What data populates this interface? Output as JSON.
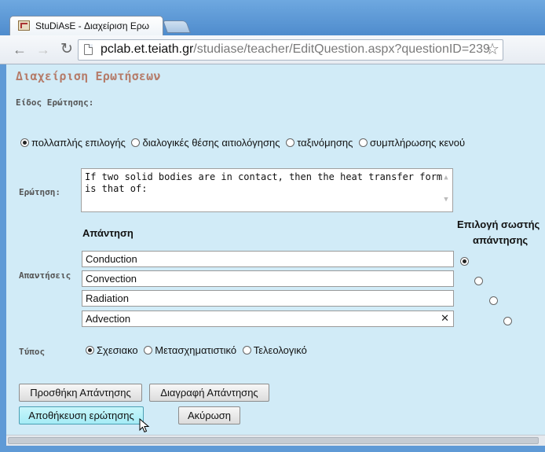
{
  "browser": {
    "tab_title": "StuDiAsE - Διαχείριση Ερω",
    "url_host": "pclab.et.teiath.gr",
    "url_path": "/studiase/teacher/EditQuestion.aspx?questionID=239"
  },
  "page": {
    "title": "Διαχείριση Ερωτήσεων",
    "question_type_label": "Είδος Ερώτησης:",
    "question_types": [
      {
        "label": "πολλαπλής επιλογής",
        "checked": true
      },
      {
        "label": "διαλογικές θέσης αιτιολόγησης",
        "checked": false
      },
      {
        "label": "ταξινόμησης",
        "checked": false
      },
      {
        "label": "συμπλήρωσης κενού",
        "checked": false
      }
    ],
    "question_label": "Ερώτηση:",
    "question_text": "If two solid bodies are in contact, then the heat transfer form is that of:",
    "answers_label": "Απαντήσεις",
    "answer_header": "Απάντηση",
    "correct_header_line1": "Επιλογή σωστής",
    "correct_header_line2": "απάντησης",
    "answers": [
      {
        "value": "Conduction",
        "correct": true
      },
      {
        "value": "Convection",
        "correct": false
      },
      {
        "value": "Radiation",
        "correct": false
      },
      {
        "value": "Advection",
        "correct": false
      }
    ],
    "type_label": "Τύπος",
    "types": [
      {
        "label": "Σχεσιακο",
        "checked": true
      },
      {
        "label": "Μετασχηματιστικό",
        "checked": false
      },
      {
        "label": "Τελεολογικό",
        "checked": false
      }
    ],
    "buttons": {
      "add_answer": "Προσθήκη Απάντησης",
      "delete_answer": "Διαγραφή Απάντησης",
      "save_question": "Αποθήκευση ερώτησης",
      "cancel": "Ακύρωση"
    }
  }
}
